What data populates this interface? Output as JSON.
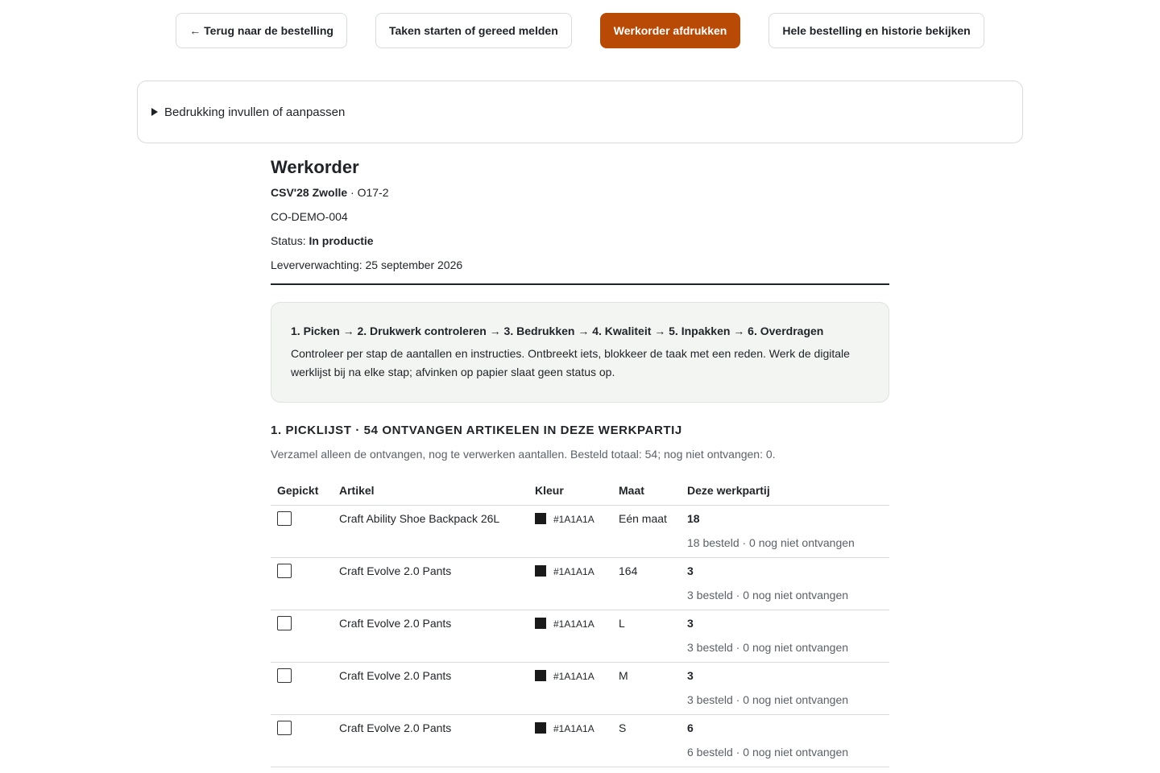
{
  "toolbar": {
    "back_label": "← Terug naar de bestelling",
    "tasks_label": "Taken starten of gereed melden",
    "print_label": "Werkorder afdrukken",
    "history_label": "Hele bestelling en historie bekijken"
  },
  "print_details": {
    "summary": "Bedrukking invullen of aanpassen"
  },
  "workorder": {
    "title": "Werkorder",
    "club": "CSV'28 Zwolle",
    "separator": " · ",
    "order_ref": "O17-2",
    "code": "CO-DEMO-004",
    "status_label": "Status: ",
    "status_value": "In productie",
    "delivery_label": "Leververwachting: ",
    "delivery_value": "25 september 2026"
  },
  "steps": {
    "flow": "1. Picken → 2. Drukwerk controleren → 3. Bedrukken → 4. Kwaliteit → 5. Inpakken → 6. Overdragen",
    "description": "Controleer per stap de aantallen en instructies. Ontbreekt iets, blokkeer de taak met een reden. Werk de digitale werklijst bij na elke stap; afvinken op papier slaat geen status op."
  },
  "picklist": {
    "title": "1. PICKLIJST · 54 ONTVANGEN ARTIKELEN IN DEZE WERKPARTIJ",
    "subtitle": "Verzamel alleen de ontvangen, nog te verwerken aantallen. Besteld totaal: 54; nog niet ontvangen: 0.",
    "columns": [
      "Gepickt",
      "Artikel",
      "Kleur",
      "Maat",
      "Deze werkpartij"
    ],
    "rows": [
      {
        "article": "Craft Ability Shoe Backpack 26L",
        "color": "#1A1A1A",
        "size": "Eén maat",
        "qty": "18",
        "qty_detail": "18 besteld · 0 nog niet ontvangen"
      },
      {
        "article": "Craft Evolve 2.0 Pants",
        "color": "#1A1A1A",
        "size": "164",
        "qty": "3",
        "qty_detail": "3 besteld · 0 nog niet ontvangen"
      },
      {
        "article": "Craft Evolve 2.0 Pants",
        "color": "#1A1A1A",
        "size": "L",
        "qty": "3",
        "qty_detail": "3 besteld · 0 nog niet ontvangen"
      },
      {
        "article": "Craft Evolve 2.0 Pants",
        "color": "#1A1A1A",
        "size": "M",
        "qty": "3",
        "qty_detail": "3 besteld · 0 nog niet ontvangen"
      },
      {
        "article": "Craft Evolve 2.0 Pants",
        "color": "#1A1A1A",
        "size": "S",
        "qty": "6",
        "qty_detail": "6 besteld · 0 nog niet ontvangen"
      }
    ]
  },
  "colors": {
    "accent": "#b94a06",
    "swatch": "#1A1A1A"
  }
}
